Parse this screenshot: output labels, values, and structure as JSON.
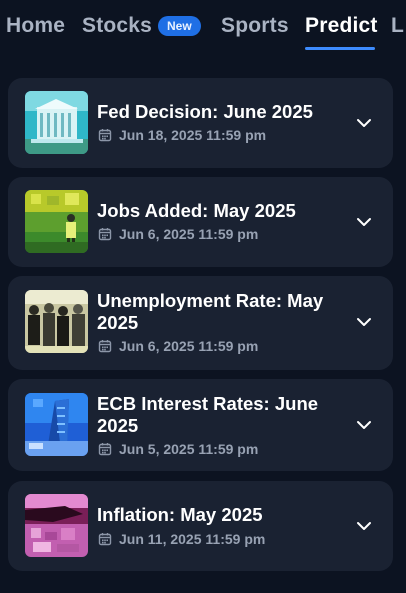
{
  "nav": {
    "tabs": [
      {
        "label": "Home"
      },
      {
        "label": "Stocks",
        "badge": "New"
      },
      {
        "label": "Sports"
      },
      {
        "label": "Predict",
        "active": true
      },
      {
        "label": "L"
      }
    ],
    "accent": "#3d8bfd"
  },
  "markets": [
    {
      "title": "Fed Decision: June 2025",
      "date": "Jun 18, 2025 11:59 pm",
      "thumb_icon": "federal-reserve-building-icon"
    },
    {
      "title": "Jobs Added: May 2025",
      "date": "Jun 6, 2025 11:59 pm",
      "thumb_icon": "worker-icon"
    },
    {
      "title": "Unemployment Rate: May 2025",
      "date": "Jun 6, 2025 11:59 pm",
      "thumb_icon": "crowd-icon"
    },
    {
      "title": "ECB Interest Rates: June 2025",
      "date": "Jun 5, 2025 11:59 pm",
      "thumb_icon": "ecb-tower-icon"
    },
    {
      "title": "Inflation: May 2025",
      "date": "Jun 11, 2025 11:59 pm",
      "thumb_icon": "inflation-icon"
    }
  ]
}
